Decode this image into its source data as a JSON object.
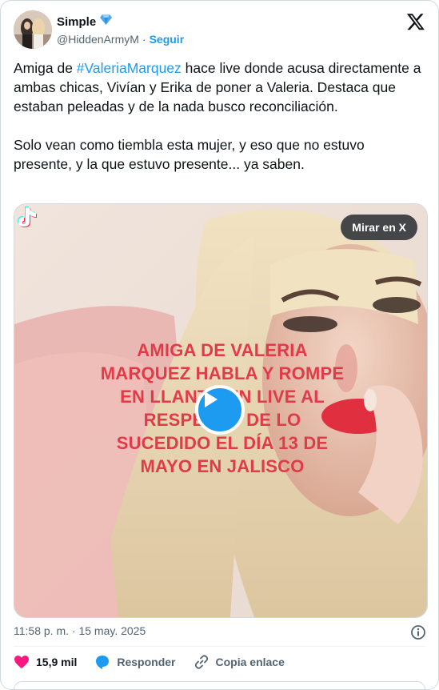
{
  "author": {
    "display_name": "Simple",
    "handle": "@HiddenArmyM",
    "follow_label": "Seguir",
    "verified_badge_icon": "blue-diamond-icon"
  },
  "tweet": {
    "text_before_hashtag": "Amiga de ",
    "hashtag": "#ValeriaMarquez",
    "text_after_hashtag": " hace live donde acusa directamente a ambas chicas, Vivían y Erika de poner a Valeria. Destaca que estaban peleadas y de la nada busco reconciliación.\n\nSolo vean como tiembla esta mujer, y eso que no estuvo presente, y la que estuvo presente... ya saben."
  },
  "media": {
    "watch_label": "Mirar en X",
    "overlay_text": "AMIGA DE VALERIA\nMARQUEZ HABLA  Y ROMPE\nEN LLANTO EN LIVE AL\nRESPECTO DE LO\nSUCEDIDO EL DÍA 13 DE\nMAYO EN JALISCO",
    "play_icon": "play-icon",
    "watermark_icon": "tiktok-icon"
  },
  "meta": {
    "timestamp": "11:58 p. m. · 15 may. 2025"
  },
  "actions": {
    "likes_count": "15,9 mil",
    "reply_label": "Responder",
    "copy_link_label": "Copia enlace"
  },
  "colors": {
    "accent": "#1d9bf0",
    "like": "#f91880",
    "overlay_text": "#e03b48"
  }
}
